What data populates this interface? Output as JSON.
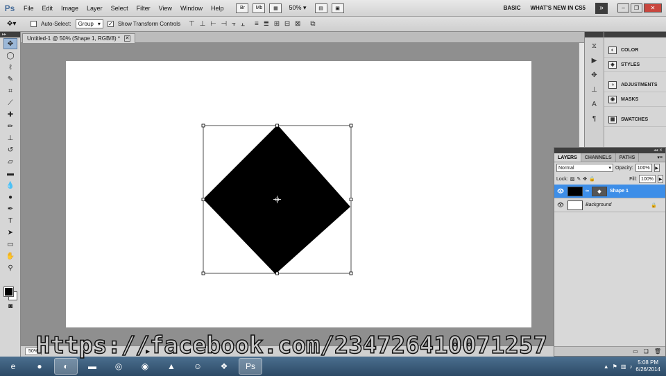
{
  "app": {
    "logo_text": "Ps",
    "menu": [
      "File",
      "Edit",
      "Image",
      "Layer",
      "Select",
      "Filter",
      "View",
      "Window",
      "Help"
    ],
    "mb_icons": [
      "Br",
      "Mb"
    ],
    "zoom": "50%",
    "workspaces": [
      "BASIC",
      "WHAT'S NEW IN CS5"
    ],
    "more_icon": "»"
  },
  "options_bar": {
    "tool_icon": "move-tool-icon",
    "auto_select_label": "Auto-Select:",
    "auto_select_checked": false,
    "auto_select_value": "Group",
    "show_transform_label": "Show Transform Controls",
    "show_transform_checked": true
  },
  "document": {
    "tab_title": "Untitled-1 @ 50% (Shape 1, RGB/8) *",
    "canvas_color": "#ffffff",
    "shape_color": "#000000"
  },
  "status": {
    "zoom": "50%"
  },
  "right_panels": [
    {
      "label": "COLOR",
      "icon": "color-icon"
    },
    {
      "label": "STYLES",
      "icon": "styles-icon"
    },
    {
      "label": "ADJUSTMENTS",
      "icon": "adjustments-icon"
    },
    {
      "label": "MASKS",
      "icon": "masks-icon"
    },
    {
      "label": "SWATCHES",
      "icon": "swatches-icon"
    }
  ],
  "layers_panel": {
    "tabs": [
      "LAYERS",
      "CHANNELS",
      "PATHS"
    ],
    "blend_mode": "Normal",
    "opacity_label": "Opacity:",
    "opacity": "100%",
    "lock_label": "Lock:",
    "fill_label": "Fill:",
    "fill": "100%",
    "layers": [
      {
        "name": "Shape 1",
        "selected": true
      },
      {
        "name": "Background",
        "selected": false
      }
    ]
  },
  "taskbar": {
    "time": "5:08 PM",
    "date": "6/26/2014",
    "active_app": "Ps"
  },
  "watermark": {
    "text": "Https://facebook.com/234726410071257"
  }
}
